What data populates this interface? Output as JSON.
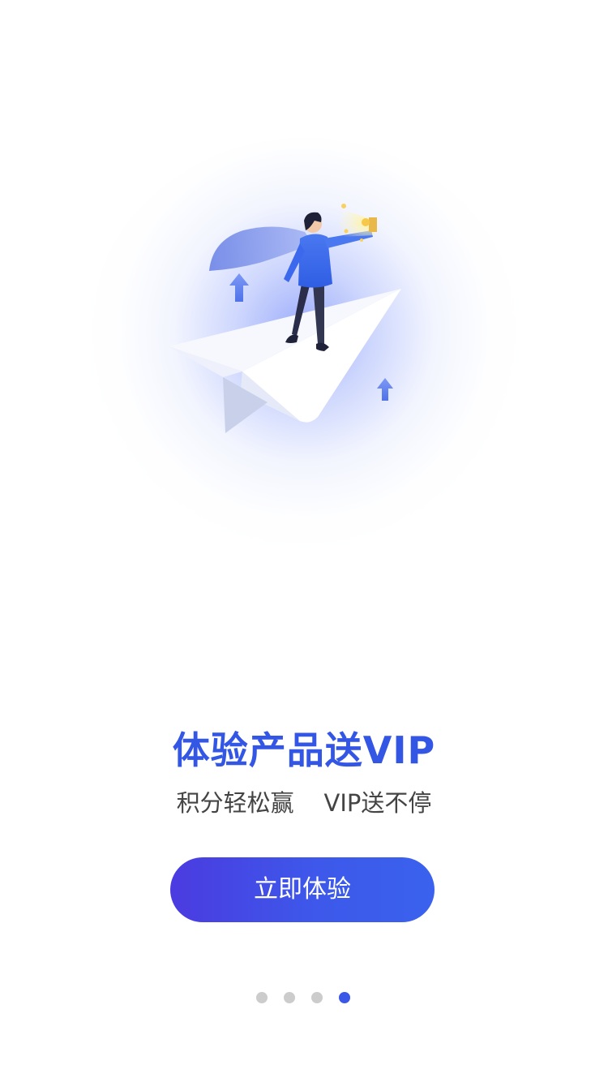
{
  "headline": "体验产品送VIP",
  "subline": "积分轻松赢    VIP送不停",
  "cta": {
    "label": "立即体验"
  },
  "pager": {
    "total": 4,
    "current": 4
  },
  "colors": {
    "accent": "#3456e4",
    "button_start": "#4b3be0",
    "button_end": "#3a62ee",
    "dot_inactive": "#cccccc",
    "dot_active": "#3a57e8"
  },
  "illustration": {
    "subject": "person-with-cape-riding-paper-plane",
    "icons": [
      "up-arrow-icon",
      "up-arrow-icon",
      "coin-icon"
    ]
  }
}
